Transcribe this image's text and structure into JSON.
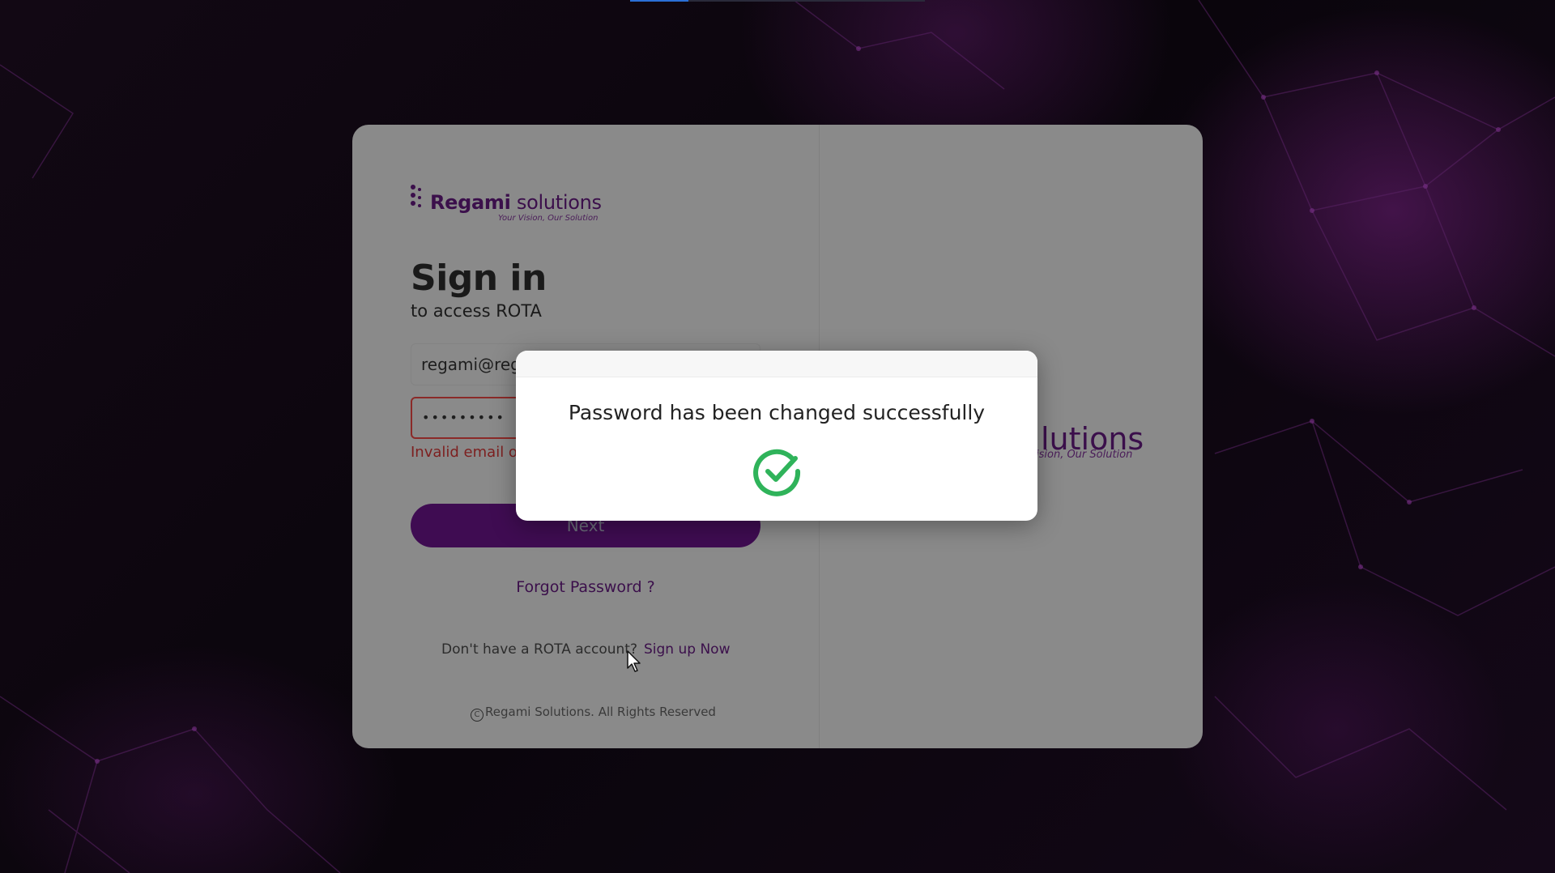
{
  "brand": {
    "name_bold": "Regami",
    "name_light": " solutions",
    "tagline": "Your Vision, Our Solution",
    "right_partial": "lutions",
    "right_tagline": "ision, Our Solution",
    "color": "#3b0f4b"
  },
  "signin": {
    "title": "Sign in",
    "subtitle": "to access ROTA",
    "email_value": "regami@reg",
    "password_value": "•••••••••",
    "error": "Invalid email o",
    "next_label": "Next",
    "forgot_label": "Forgot Password ?",
    "no_account_text": "Don't have a ROTA account?",
    "signup_label": "Sign up Now",
    "copyright": "Regami Solutions. All Rights Reserved",
    "copyright_symbol": "C"
  },
  "modal": {
    "message": "Password has been changed successfully",
    "icon": "check-circle-icon",
    "icon_color": "#2fb35a"
  }
}
